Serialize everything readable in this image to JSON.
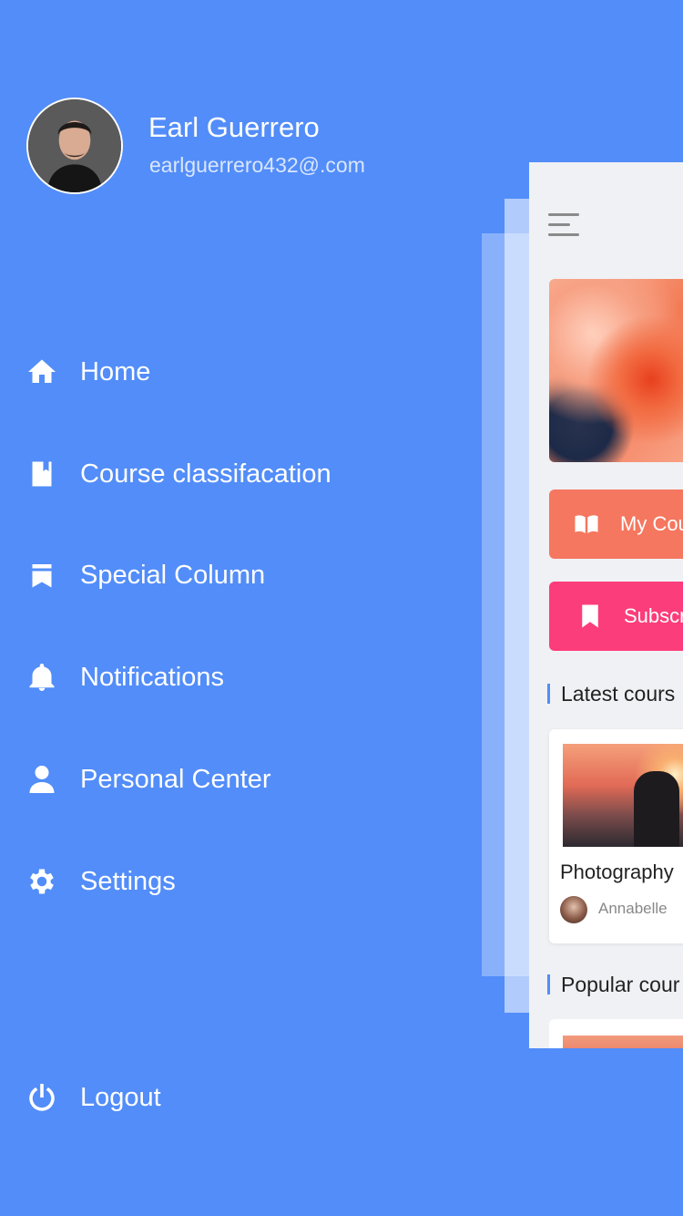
{
  "user": {
    "name": "Earl Guerrero",
    "email": "earlguerrero432@.com"
  },
  "menu": {
    "items": [
      {
        "label": "Home",
        "icon": "home-icon"
      },
      {
        "label": "Course classifacation",
        "icon": "book-icon"
      },
      {
        "label": "Special Column",
        "icon": "bookmark-icon"
      },
      {
        "label": "Notifications",
        "icon": "bell-icon"
      },
      {
        "label": "Personal Center",
        "icon": "person-icon"
      },
      {
        "label": "Settings",
        "icon": "gear-icon"
      }
    ],
    "logout": {
      "label": "Logout",
      "icon": "power-icon"
    }
  },
  "preview": {
    "buttons": {
      "my_courses": "My Cou",
      "subscriptions": "Subscri"
    },
    "sections": {
      "latest": "Latest cours",
      "popular": "Popular cour"
    },
    "latest_card": {
      "title": "Photography",
      "author": "Annabelle"
    }
  },
  "colors": {
    "drawer_bg": "#528df9",
    "preview_bg": "#f0f1f5",
    "my_courses_pill": "#f5775f",
    "subscriptions_pill": "#fc3d7b"
  }
}
